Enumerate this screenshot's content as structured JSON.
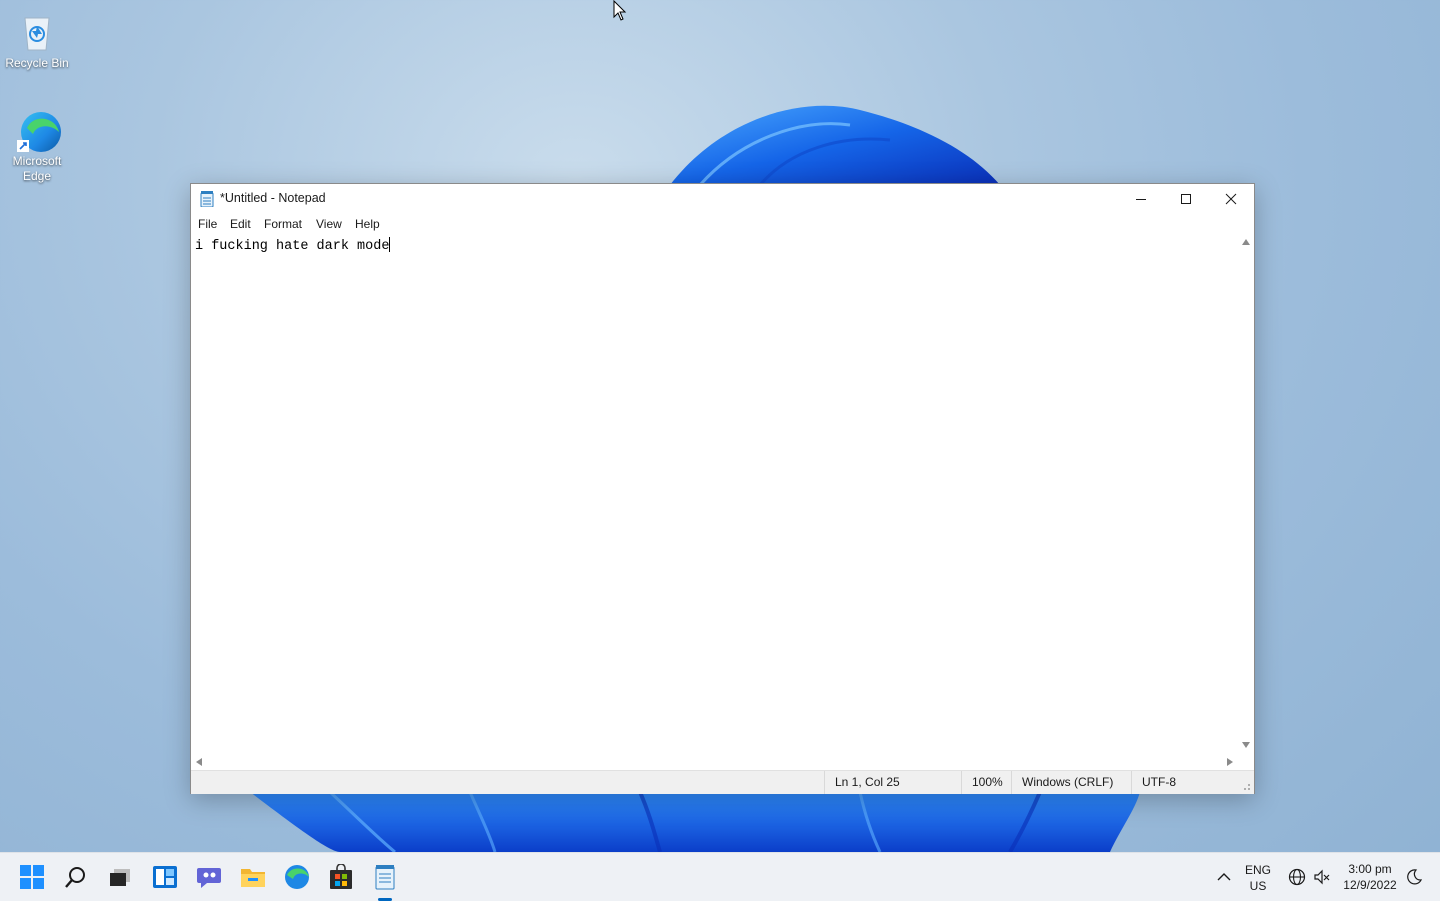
{
  "desktop": {
    "icons": [
      {
        "label": "Recycle Bin",
        "icon": "recycle-bin-icon"
      },
      {
        "label": "Microsoft Edge",
        "icon": "edge-icon"
      }
    ]
  },
  "window": {
    "title": "*Untitled - Notepad",
    "menu": [
      "File",
      "Edit",
      "Format",
      "View",
      "Help"
    ],
    "content": "i fucking hate dark mode",
    "status": {
      "position": "Ln 1, Col 25",
      "zoom": "100%",
      "line_ending": "Windows (CRLF)",
      "encoding": "UTF-8"
    }
  },
  "taskbar": {
    "apps": [
      "start-icon",
      "search-icon",
      "task-view-icon",
      "widgets-icon",
      "chat-icon",
      "file-explorer-icon",
      "edge-icon",
      "store-icon",
      "notepad-icon"
    ],
    "language": {
      "line1": "ENG",
      "line2": "US"
    },
    "time": "3:00 pm",
    "date": "12/9/2022"
  },
  "colors": {
    "accent": "#0067c0",
    "taskbar": "#eef1f5"
  }
}
